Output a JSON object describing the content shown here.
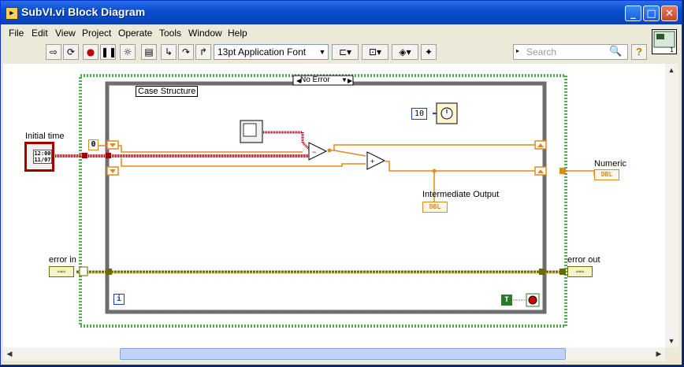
{
  "window": {
    "title": "SubVI.vi Block Diagram",
    "minimize": "_",
    "maximize": "□",
    "close": "✕"
  },
  "menu": {
    "items": [
      "File",
      "Edit",
      "View",
      "Project",
      "Operate",
      "Tools",
      "Window",
      "Help"
    ]
  },
  "toolbar": {
    "font": "13pt Application Font",
    "search_placeholder": "Search",
    "help": "?"
  },
  "diagram": {
    "case_selector": "No Error",
    "case_label": "Case Structure",
    "initial_time_label": "Initial time",
    "numeric_label": "Numeric",
    "intermediate_label": "Intermediate Output",
    "error_in_label": "error in",
    "error_out_label": "error out",
    "shift_register_init": "0",
    "wait_constant": "10",
    "dbl_text": "DBL",
    "iteration_text": "i",
    "true_constant": "T"
  },
  "colors": {
    "accent": "#0a46c8",
    "orange_wire": "#e08a1e",
    "timestamp_wire": "#a00000",
    "error_wire": "#6b6b00",
    "loop_border": "#4fb04f"
  }
}
